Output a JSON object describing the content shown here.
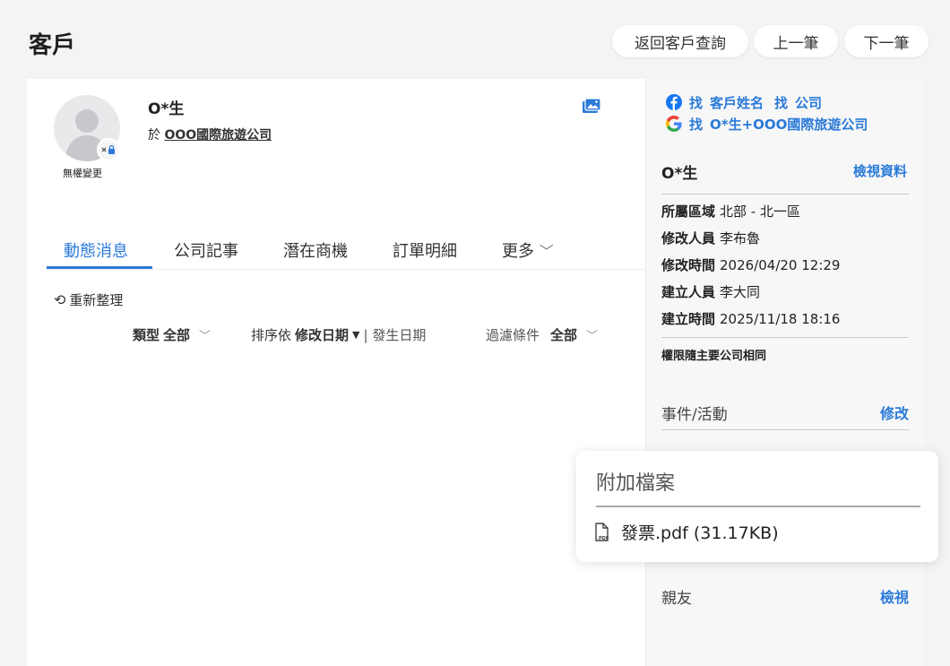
{
  "page": {
    "title": "客戶"
  },
  "header_buttons": {
    "back": "返回客戶查詢",
    "prev": "上一筆",
    "next": "下一筆"
  },
  "customer": {
    "name": "O*生",
    "company_prefix": "於",
    "company": "OOO國際旅遊公司",
    "permission_label": "無權變更"
  },
  "tabs": [
    {
      "label": "動態消息",
      "active": true
    },
    {
      "label": "公司記事"
    },
    {
      "label": "潛在商機"
    },
    {
      "label": "訂單明細"
    },
    {
      "label": "更多"
    }
  ],
  "feed": {
    "refresh": "重新整理",
    "type_label": "類型",
    "type_value": "全部",
    "sort_label": "排序依",
    "sort_value": "修改日期",
    "sort_alt": "| 發生日期",
    "filter_label": "過濾條件",
    "filter_value": "全部"
  },
  "side": {
    "search_row1": {
      "prefix": "找",
      "link1": "客戶姓名",
      "prefix2": "找",
      "link2": "公司"
    },
    "search_row2": {
      "prefix": "找",
      "link": "O*生+OOO國際旅遊公司"
    },
    "name": "O*生",
    "view_data": "檢視資料",
    "info": [
      {
        "label": "所屬區域",
        "value": "北部 - 北一區"
      },
      {
        "label": "修改人員",
        "value": "李布魯"
      },
      {
        "label": "修改時間",
        "value": "2026/04/20 12:29"
      },
      {
        "label": "建立人員",
        "value": "李大同"
      },
      {
        "label": "建立時間",
        "value": "2025/11/18 18:16"
      }
    ],
    "permission_note": "權限隨主要公司相同",
    "events_title": "事件/活動",
    "events_action": "修改",
    "friends_title": "親友",
    "friends_action": "檢視"
  },
  "attachment_popup": {
    "title": "附加檔案",
    "file": "發票.pdf (31.17KB)"
  },
  "colors": {
    "accent": "#2a7ad8",
    "facebook": "#1877f2"
  },
  "icons": {
    "photo": "image-icon",
    "facebook": "facebook-icon",
    "google": "google-icon",
    "refresh": "refresh-icon",
    "pdf": "pdf-file-icon"
  }
}
